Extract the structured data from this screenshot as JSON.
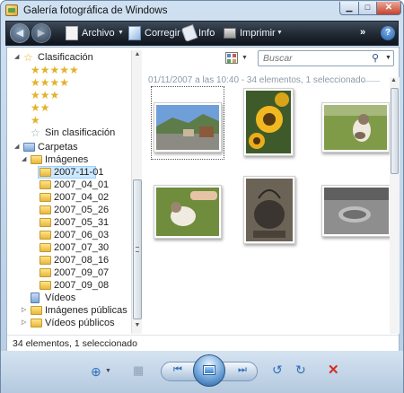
{
  "window": {
    "title": "Galería fotográfica de Windows"
  },
  "toolbar": {
    "file_label": "Archivo",
    "fix_label": "Corregir",
    "info_label": "Info",
    "print_label": "Imprimir"
  },
  "tree": {
    "rating_header": "Clasificación",
    "ratings": [
      "★★★★★",
      "★★★★",
      "★★★",
      "★★",
      "★"
    ],
    "unrated": "Sin clasificación",
    "folders_header": "Carpetas",
    "images_folder": "Imágenes",
    "subfolders": [
      "2007-11-01",
      "2007_04_01",
      "2007_04_02",
      "2007_05_26",
      "2007_05_31",
      "2007_06_03",
      "2007_07_30",
      "2007_08_16",
      "2007_09_07",
      "2007_09_08"
    ],
    "videos": "Vídeos",
    "public_images": "Imágenes públicas",
    "public_videos": "Vídeos públicos"
  },
  "search": {
    "placeholder": "Buscar"
  },
  "group_header": "01/11/2007 a las 10:40 - 34 elementos, 1 seleccionado",
  "status": {
    "text": "34 elementos, 1 seleccionado"
  },
  "colors": {
    "toolbar": "#232b36",
    "selection": "#cde8ff",
    "accent": "#2d6fba"
  }
}
